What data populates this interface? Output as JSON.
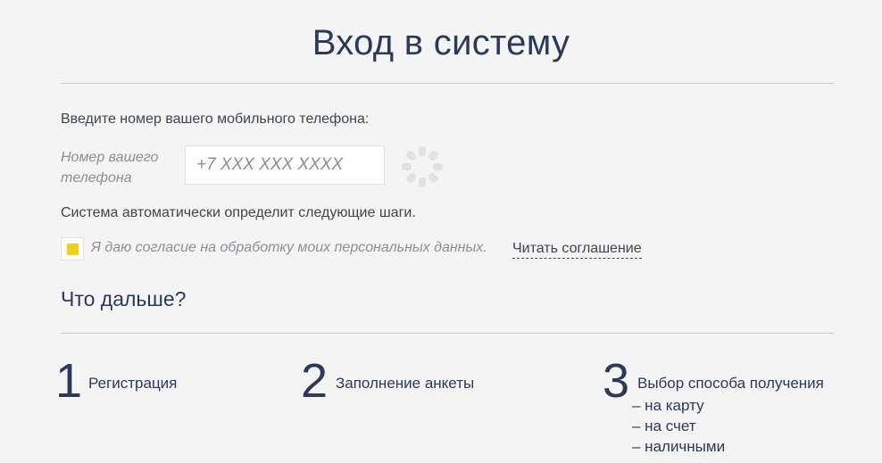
{
  "header": {
    "title": "Вход в систему"
  },
  "form": {
    "prompt": "Введите номер вашего мобильного телефона:",
    "phone_label": "Номер вашего телефона",
    "phone_placeholder": "+7 XXX XXX XXXX",
    "phone_value": "",
    "auto_text": "Система автоматически определит следующие шаги.",
    "consent_checked": true,
    "consent_text": "Я даю согласие на обработку моих персональных данных.",
    "consent_link": "Читать соглашение"
  },
  "next": {
    "heading": "Что дальше?",
    "steps": [
      {
        "number": "1",
        "label": "Регистрация"
      },
      {
        "number": "2",
        "label": "Заполнение анкеты"
      },
      {
        "number": "3",
        "label": "Выбор способа получения"
      }
    ],
    "options": [
      "– на карту",
      "– на счет",
      "– наличными"
    ]
  },
  "colors": {
    "accent": "#f0cf1c",
    "heading": "#2c3a57",
    "background": "#f4f4f4",
    "muted": "#8a8f96"
  },
  "icons": {
    "loading": "loading-spinner-icon",
    "checkbox": "checkbox-checked-icon"
  }
}
